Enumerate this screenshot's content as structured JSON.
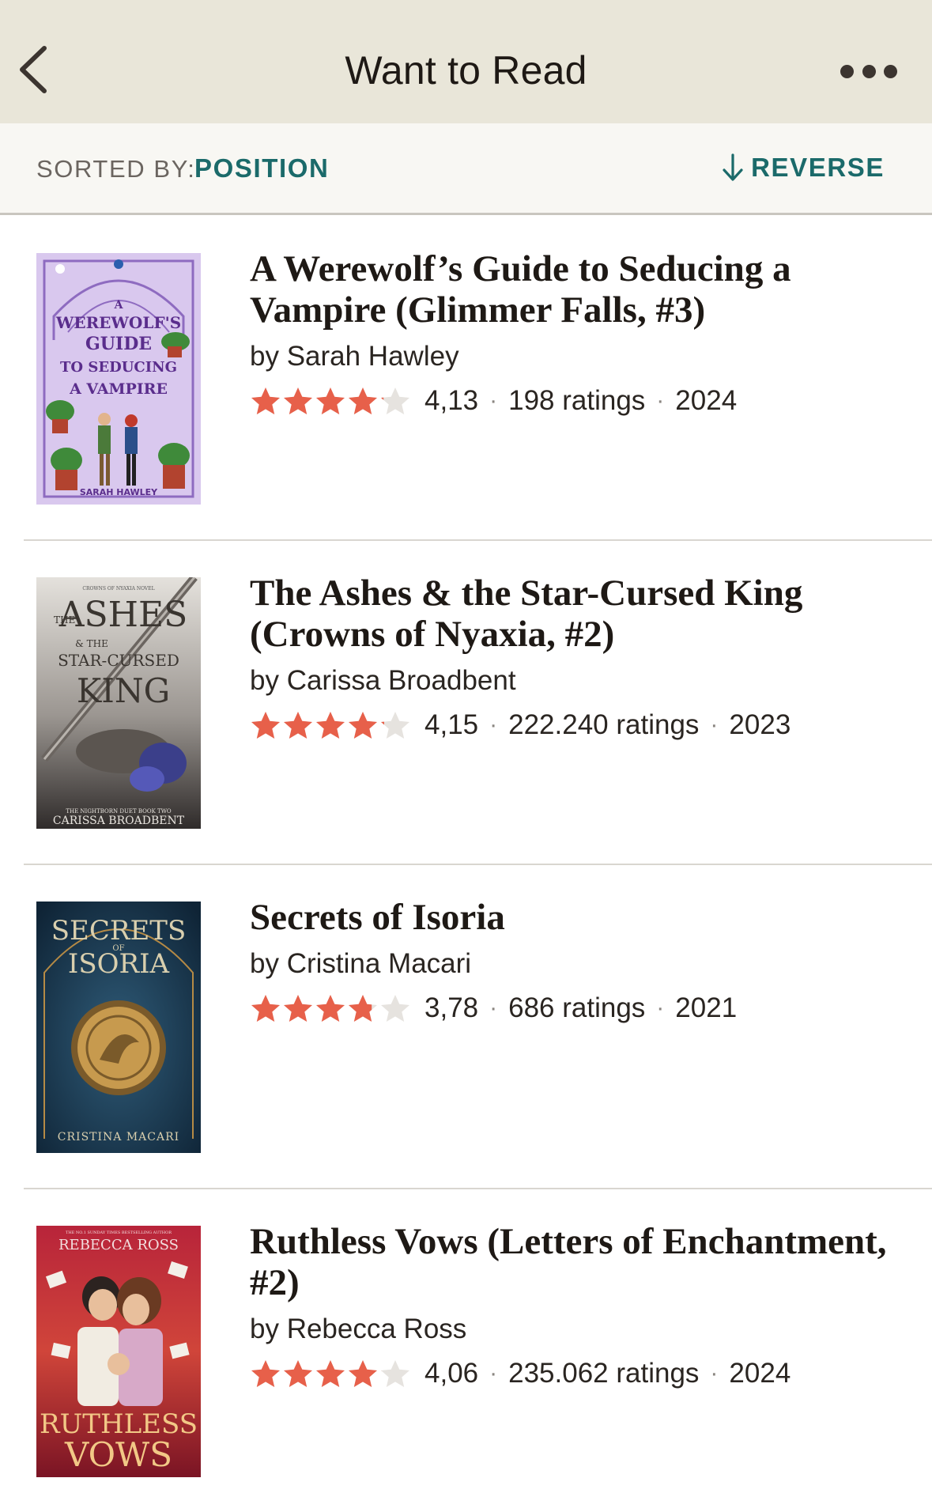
{
  "header": {
    "title": "Want to Read",
    "back_icon": "chevron-left-icon",
    "more_icon": "more-horizontal-icon"
  },
  "sortbar": {
    "sorted_by_label": "SORTED BY:",
    "sort_value": "POSITION",
    "reverse_label": "REVERSE",
    "reverse_icon": "arrow-down-icon"
  },
  "colors": {
    "header_bg": "#e9e6d9",
    "accent": "#1b6a6a",
    "star_fill": "#e7604a",
    "star_empty": "#e6e3df"
  },
  "books": [
    {
      "title": "A Werewolf’s Guide to Seducing a Vampire (Glimmer Falls, #3)",
      "author": "by Sarah Hawley",
      "rating": "4,13",
      "rating_value": 4.13,
      "ratings": "198 ratings",
      "year": "2024",
      "cover": {
        "lines": [
          "A",
          "WEREWOLF'S",
          "GUIDE",
          "TO SEDUCING",
          "A VAMPIRE"
        ],
        "author": "SARAH HAWLEY"
      }
    },
    {
      "title": "The Ashes & the Star-Cursed King (Crowns of Nyaxia, #2)",
      "author": "by Carissa Broadbent",
      "rating": "4,15",
      "rating_value": 4.15,
      "ratings": "222.240 ratings",
      "year": "2023",
      "cover": {
        "top": "CROWNS OF NYAXIA NOVEL",
        "lines": [
          "THE",
          "ASHES",
          "& THE",
          "STAR-CURSED",
          "KING"
        ],
        "series_line": "THE NIGHTBORN DUET BOOK TWO",
        "author": "CARISSA BROADBENT"
      }
    },
    {
      "title": "Secrets of Isoria",
      "author": "by Cristina Macari",
      "rating": "3,78",
      "rating_value": 3.78,
      "ratings": "686 ratings",
      "year": "2021",
      "cover": {
        "lines": [
          "SECRETS",
          "OF",
          "ISORIA"
        ],
        "author": "CRISTINA MACARI"
      }
    },
    {
      "title": "Ruthless Vows (Letters of Enchantment, #2)",
      "author": "by Rebecca Ross",
      "rating": "4,06",
      "rating_value": 4.06,
      "ratings": "235.062 ratings",
      "year": "2024",
      "cover": {
        "top": "THE NO.1 SUNDAY TIMES BESTSELLING AUTHOR",
        "author": "REBECCA ROSS",
        "lines": [
          "RUTHLESS",
          "VOWS"
        ]
      }
    }
  ]
}
